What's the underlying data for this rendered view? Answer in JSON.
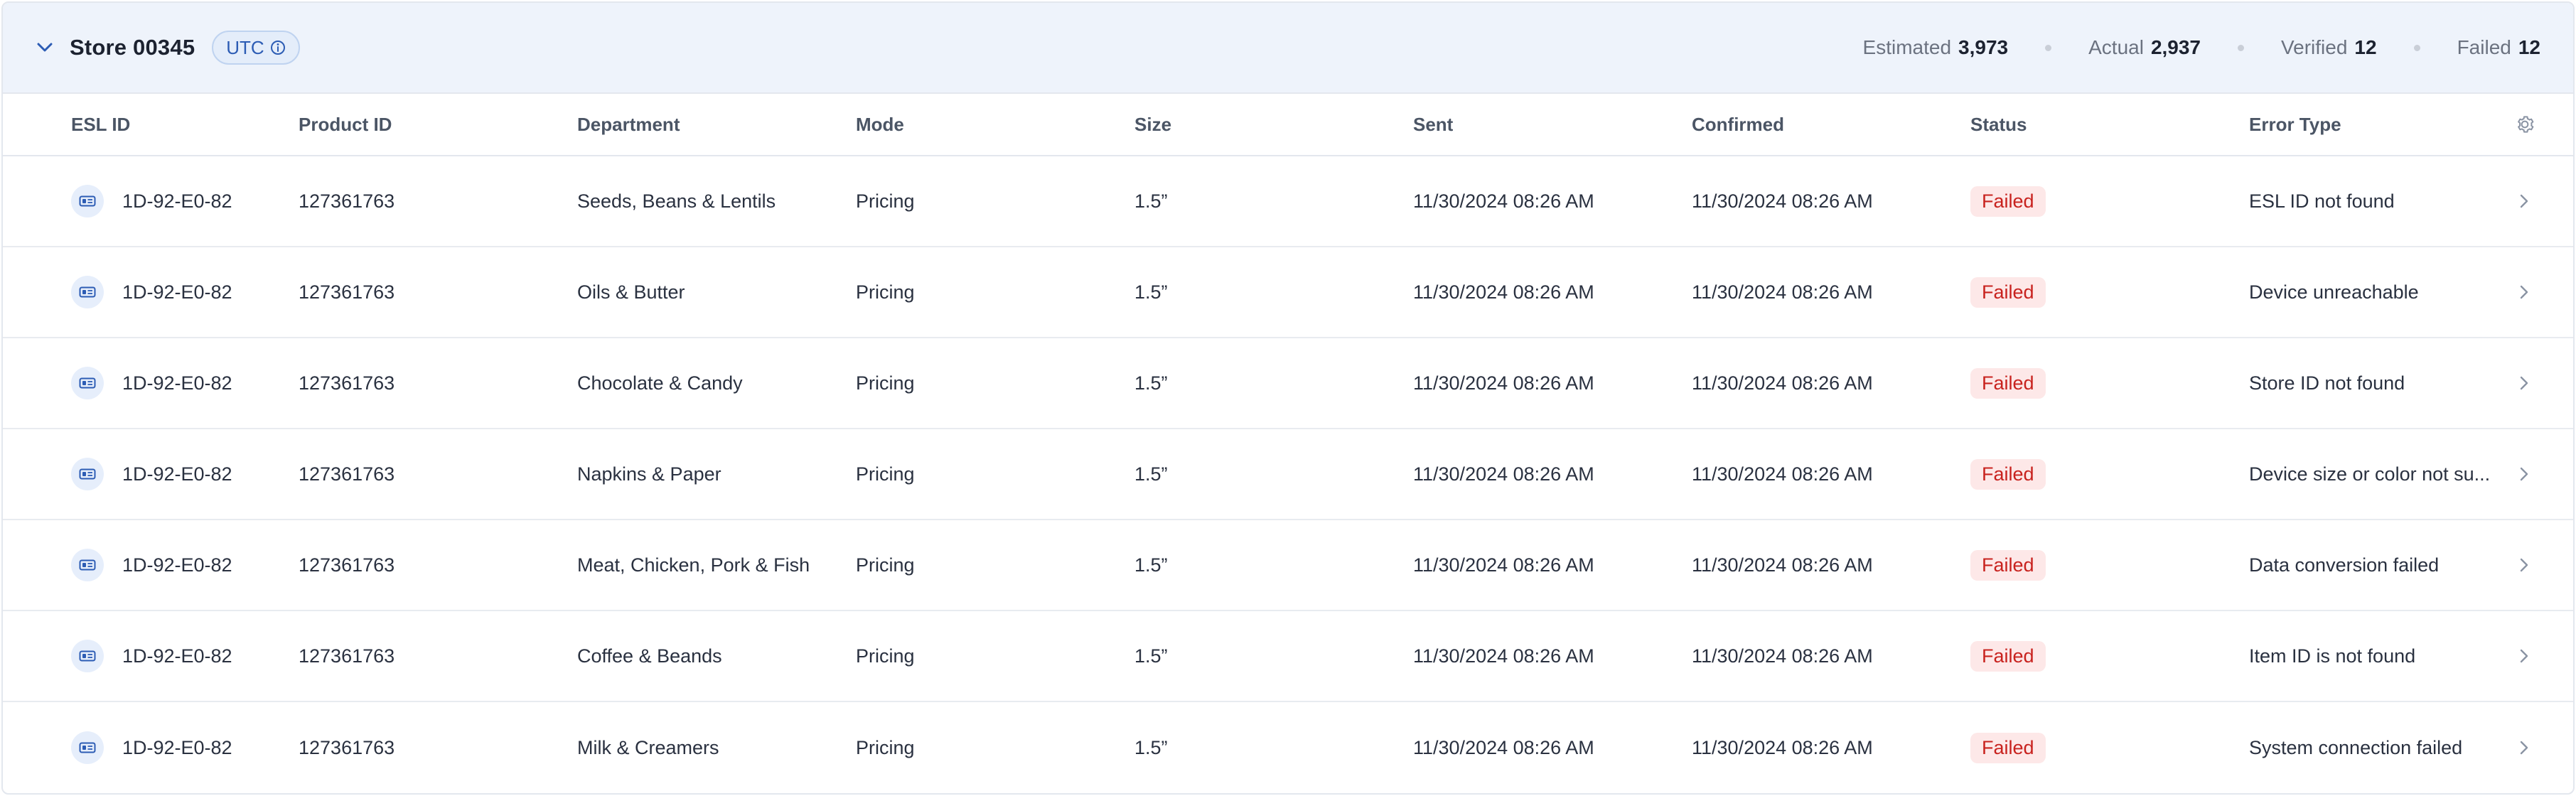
{
  "header": {
    "store_title": "Store 00345",
    "timezone": "UTC",
    "stats": [
      {
        "label": "Estimated",
        "value": "3,973"
      },
      {
        "label": "Actual",
        "value": "2,937"
      },
      {
        "label": "Verified",
        "value": "12"
      },
      {
        "label": "Failed",
        "value": "12"
      }
    ]
  },
  "columns": {
    "esl_id": "ESL ID",
    "product_id": "Product ID",
    "department": "Department",
    "mode": "Mode",
    "size": "Size",
    "sent": "Sent",
    "confirmed": "Confirmed",
    "status": "Status",
    "error_type": "Error Type"
  },
  "rows": [
    {
      "esl_id": "1D-92-E0-82",
      "product_id": "127361763",
      "department": "Seeds, Beans & Lentils",
      "mode": "Pricing",
      "size": "1.5”",
      "sent": "11/30/2024 08:26 AM",
      "confirmed": "11/30/2024 08:26 AM",
      "status": "Failed",
      "error_type": "ESL ID not found"
    },
    {
      "esl_id": "1D-92-E0-82",
      "product_id": "127361763",
      "department": "Oils & Butter",
      "mode": "Pricing",
      "size": "1.5”",
      "sent": "11/30/2024 08:26 AM",
      "confirmed": "11/30/2024 08:26 AM",
      "status": "Failed",
      "error_type": "Device unreachable"
    },
    {
      "esl_id": "1D-92-E0-82",
      "product_id": "127361763",
      "department": "Chocolate & Candy",
      "mode": "Pricing",
      "size": "1.5”",
      "sent": "11/30/2024 08:26 AM",
      "confirmed": "11/30/2024 08:26 AM",
      "status": "Failed",
      "error_type": "Store ID not found"
    },
    {
      "esl_id": "1D-92-E0-82",
      "product_id": "127361763",
      "department": "Napkins & Paper",
      "mode": "Pricing",
      "size": "1.5”",
      "sent": "11/30/2024 08:26 AM",
      "confirmed": "11/30/2024 08:26 AM",
      "status": "Failed",
      "error_type": "Device size or color not su..."
    },
    {
      "esl_id": "1D-92-E0-82",
      "product_id": "127361763",
      "department": "Meat, Chicken, Pork & Fish",
      "mode": "Pricing",
      "size": "1.5”",
      "sent": "11/30/2024 08:26 AM",
      "confirmed": "11/30/2024 08:26 AM",
      "status": "Failed",
      "error_type": "Data conversion failed"
    },
    {
      "esl_id": "1D-92-E0-82",
      "product_id": "127361763",
      "department": "Coffee & Beands",
      "mode": "Pricing",
      "size": "1.5”",
      "sent": "11/30/2024 08:26 AM",
      "confirmed": "11/30/2024 08:26 AM",
      "status": "Failed",
      "error_type": "Item ID is not found"
    },
    {
      "esl_id": "1D-92-E0-82",
      "product_id": "127361763",
      "department": "Milk & Creamers",
      "mode": "Pricing",
      "size": "1.5”",
      "sent": "11/30/2024 08:26 AM",
      "confirmed": "11/30/2024 08:26 AM",
      "status": "Failed",
      "error_type": "System connection failed"
    }
  ],
  "icons": {
    "collapse": "chevron-down-icon",
    "timezone_info": "info-icon",
    "esl": "esl-tag-icon",
    "row_open": "chevron-right-icon",
    "settings": "gear-icon"
  },
  "colors": {
    "header_bg": "#eef3fb",
    "accent": "#2c5cb4",
    "failed_text": "#c8221e",
    "failed_bg": "#fde8e8"
  }
}
